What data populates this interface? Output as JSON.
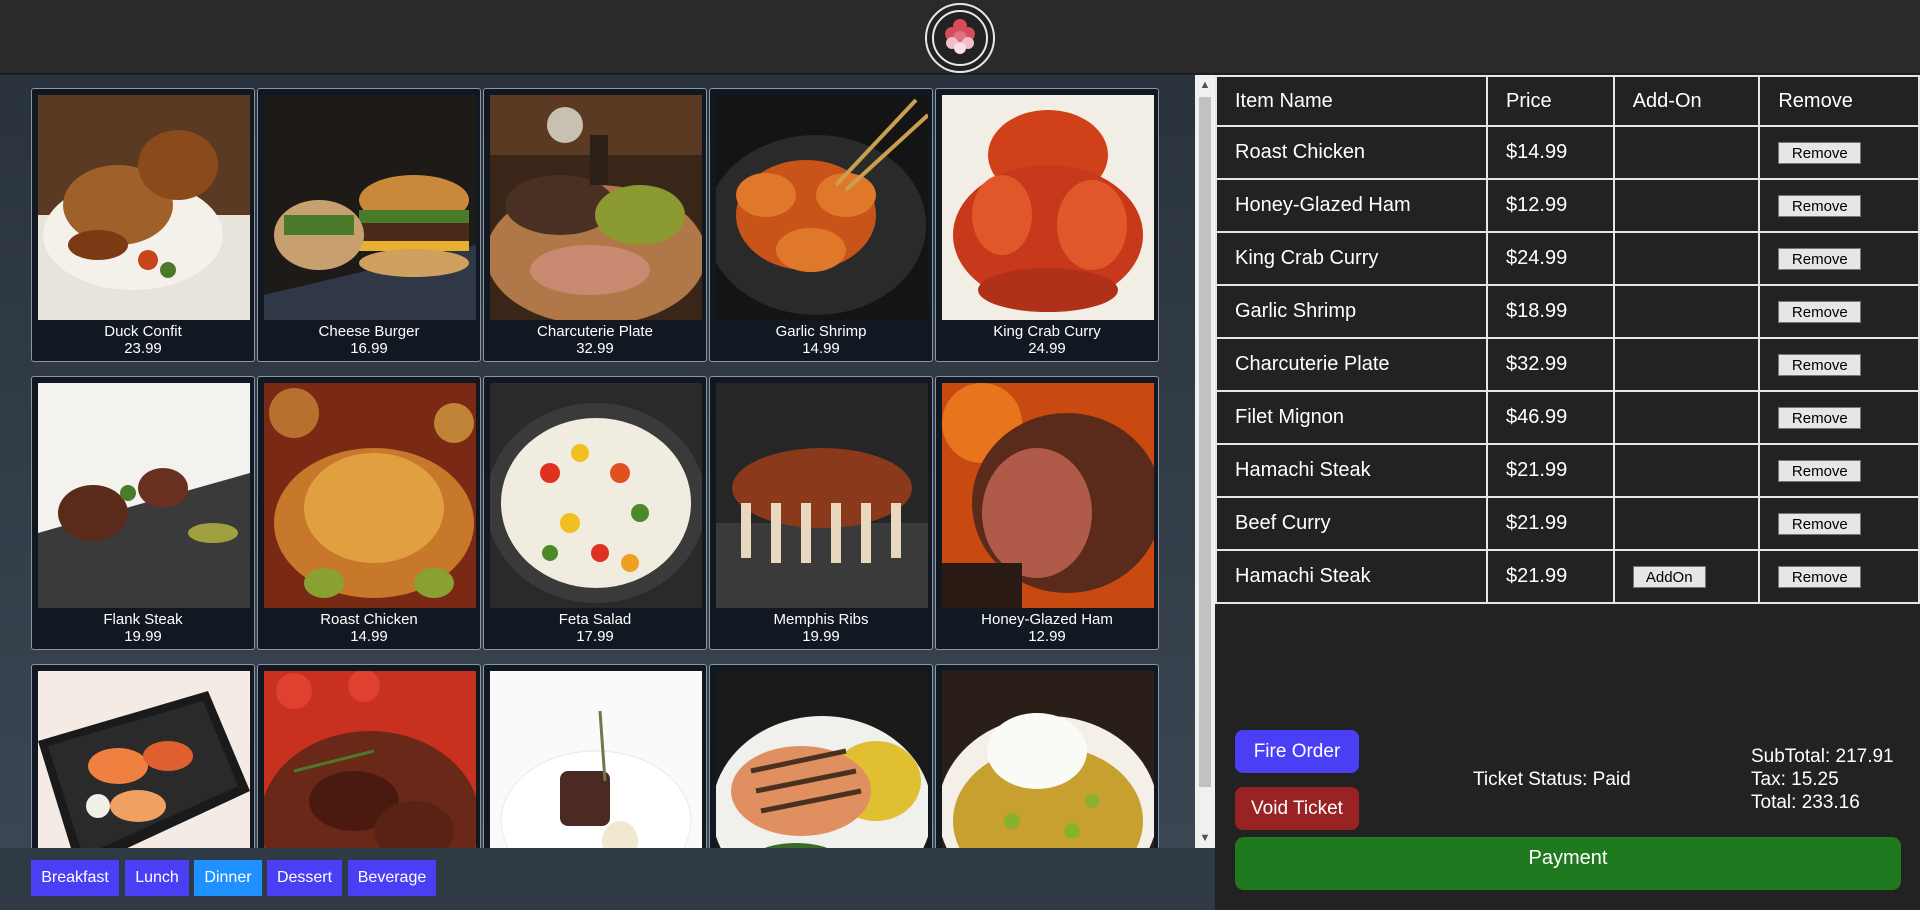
{
  "colors": {
    "category_button": "#4a3ff5",
    "category_active": "#1e90ff",
    "fire_order": "#4a3ff5",
    "void_ticket": "#992222",
    "payment": "#1f7a1f"
  },
  "header": {
    "logo_icon": "restaurant-logo-icon"
  },
  "menu": {
    "items": [
      {
        "name": "Duck Confit",
        "price": "23.99"
      },
      {
        "name": "Cheese Burger",
        "price": "16.99"
      },
      {
        "name": "Charcuterie Plate",
        "price": "32.99"
      },
      {
        "name": "Garlic Shrimp",
        "price": "14.99"
      },
      {
        "name": "King Crab Curry",
        "price": "24.99"
      },
      {
        "name": "Flank Steak",
        "price": "19.99"
      },
      {
        "name": "Roast Chicken",
        "price": "14.99"
      },
      {
        "name": "Feta Salad",
        "price": "17.99"
      },
      {
        "name": "Memphis Ribs",
        "price": "19.99"
      },
      {
        "name": "Honey-Glazed Ham",
        "price": "12.99"
      },
      {
        "name": "",
        "price": ""
      },
      {
        "name": "",
        "price": ""
      },
      {
        "name": "",
        "price": ""
      },
      {
        "name": "",
        "price": ""
      },
      {
        "name": "",
        "price": ""
      }
    ]
  },
  "categories": {
    "tabs": [
      "Breakfast",
      "Lunch",
      "Dinner",
      "Dessert",
      "Beverage"
    ],
    "selected": "Dinner"
  },
  "order": {
    "headers": {
      "name": "Item Name",
      "price": "Price",
      "addon": "Add-On",
      "remove": "Remove"
    },
    "rows": [
      {
        "name": "Roast Chicken",
        "price": "$14.99",
        "addon": "",
        "remove": "Remove"
      },
      {
        "name": "Honey-Glazed Ham",
        "price": "$12.99",
        "addon": "",
        "remove": "Remove"
      },
      {
        "name": "King Crab Curry",
        "price": "$24.99",
        "addon": "",
        "remove": "Remove"
      },
      {
        "name": "Garlic Shrimp",
        "price": "$18.99",
        "addon": "",
        "remove": "Remove"
      },
      {
        "name": "Charcuterie Plate",
        "price": "$32.99",
        "addon": "",
        "remove": "Remove"
      },
      {
        "name": "Filet Mignon",
        "price": "$46.99",
        "addon": "",
        "remove": "Remove"
      },
      {
        "name": "Hamachi Steak",
        "price": "$21.99",
        "addon": "",
        "remove": "Remove"
      },
      {
        "name": "Beef Curry",
        "price": "$21.99",
        "addon": "",
        "remove": "Remove"
      },
      {
        "name": "Hamachi Steak",
        "price": "$21.99",
        "addon": "AddOn",
        "remove": "Remove"
      }
    ]
  },
  "actions": {
    "fire_order": "Fire Order",
    "void_ticket": "Void Ticket",
    "payment": "Payment"
  },
  "ticket": {
    "status": "Ticket Status: Paid",
    "subtotal": "SubTotal: 217.91",
    "tax": "Tax: 15.25",
    "total": "Total: 233.16"
  }
}
